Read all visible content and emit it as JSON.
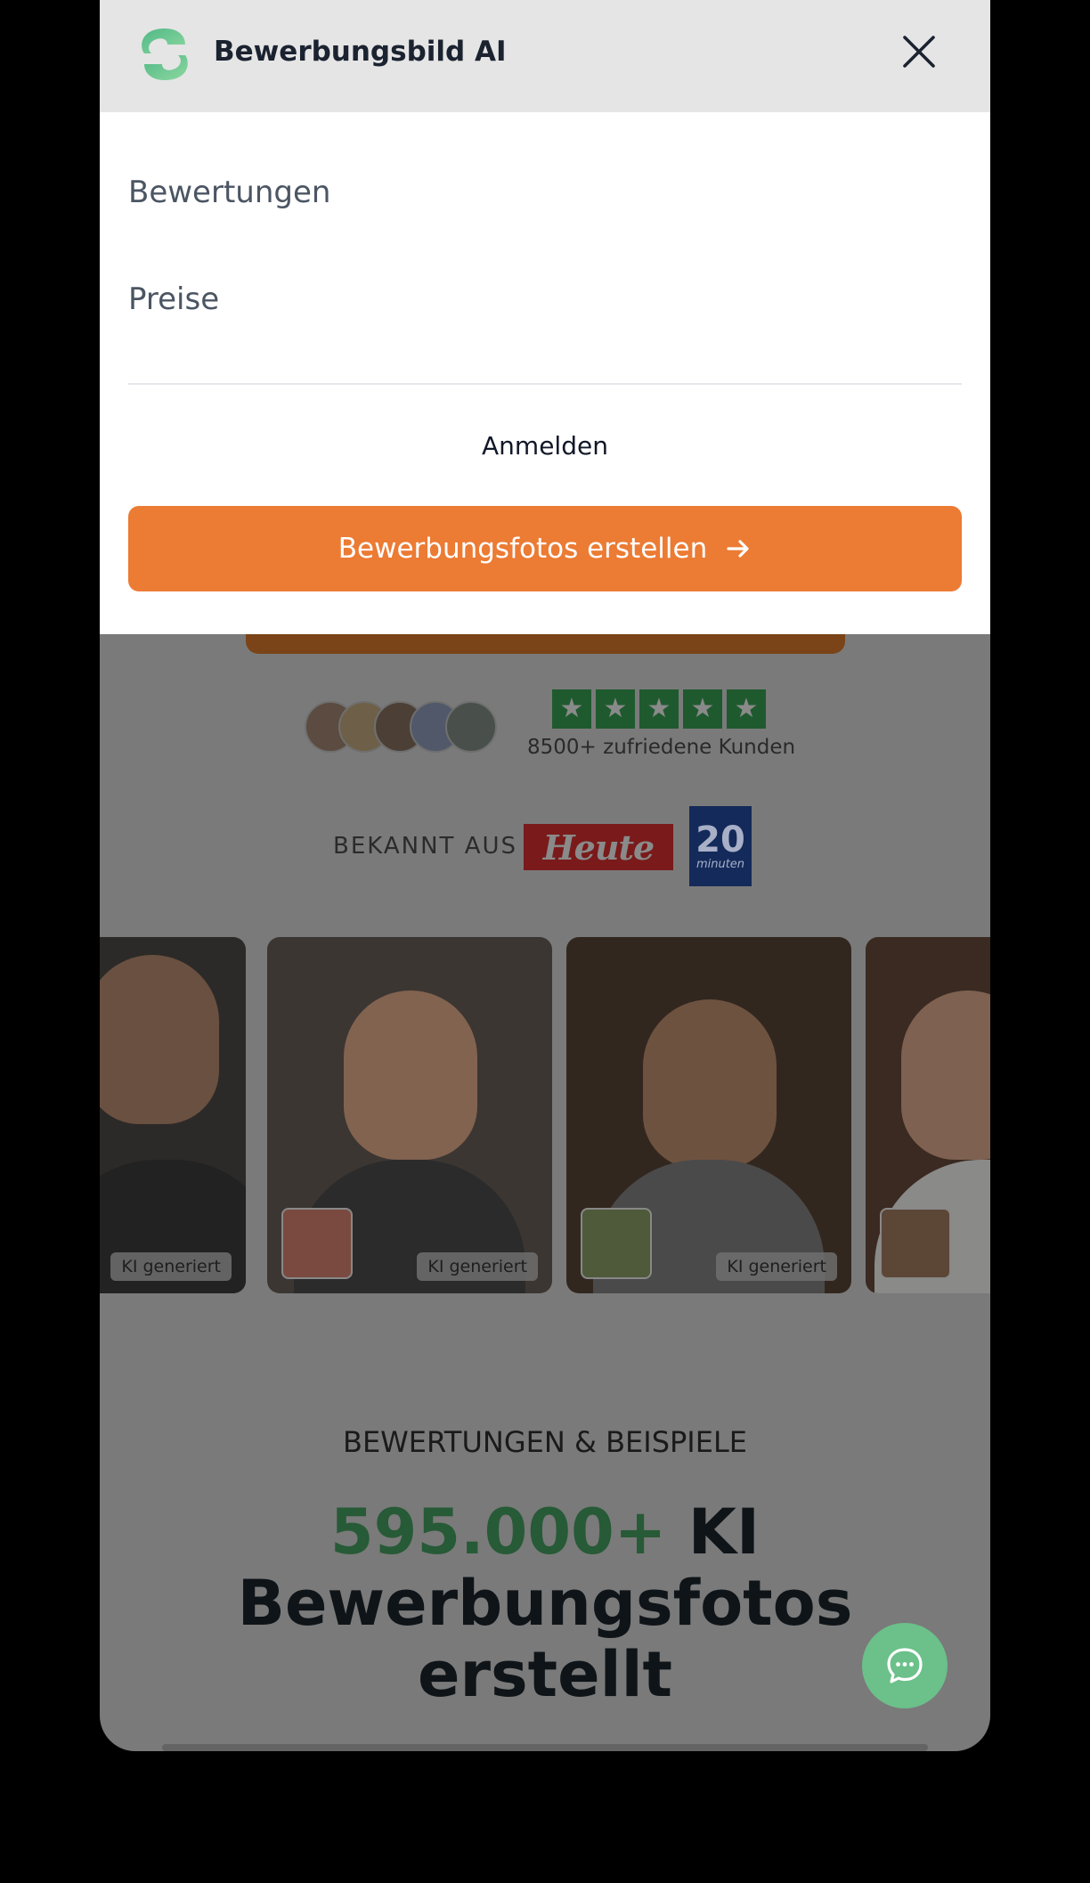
{
  "header": {
    "brand": "Bewerbungsbild AI",
    "logo_icon": "brand-logo-icon",
    "close_icon": "close-icon"
  },
  "menu": {
    "items": [
      "Bewertungen",
      "Preise"
    ],
    "login_label": "Anmelden",
    "cta_label": "Bewerbungsfotos erstellen",
    "cta_icon": "arrow-right-icon"
  },
  "social_proof": {
    "rating_stars": 5,
    "customers_label": "8500+ zufriedene Kunden"
  },
  "press": {
    "label": "BEKANNT AUS",
    "outlets": [
      {
        "name": "Heute"
      },
      {
        "name": "20",
        "sub": "minuten"
      }
    ]
  },
  "gallery": {
    "badge_label": "KI generiert"
  },
  "section": {
    "kicker": "BEWERTUNGEN & BEISPIELE",
    "headline_accent": "595.000+",
    "headline_rest_1": "KI",
    "headline_rest_2": "Bewerbungsfotos",
    "headline_rest_3": "erstellt"
  },
  "chat": {
    "icon": "chat-bubble-icon"
  },
  "colors": {
    "accent_orange": "#ec7b34",
    "accent_green": "#4a8f5e",
    "header_bg": "#e5e5e5",
    "overlay": "#7a7a7a"
  }
}
